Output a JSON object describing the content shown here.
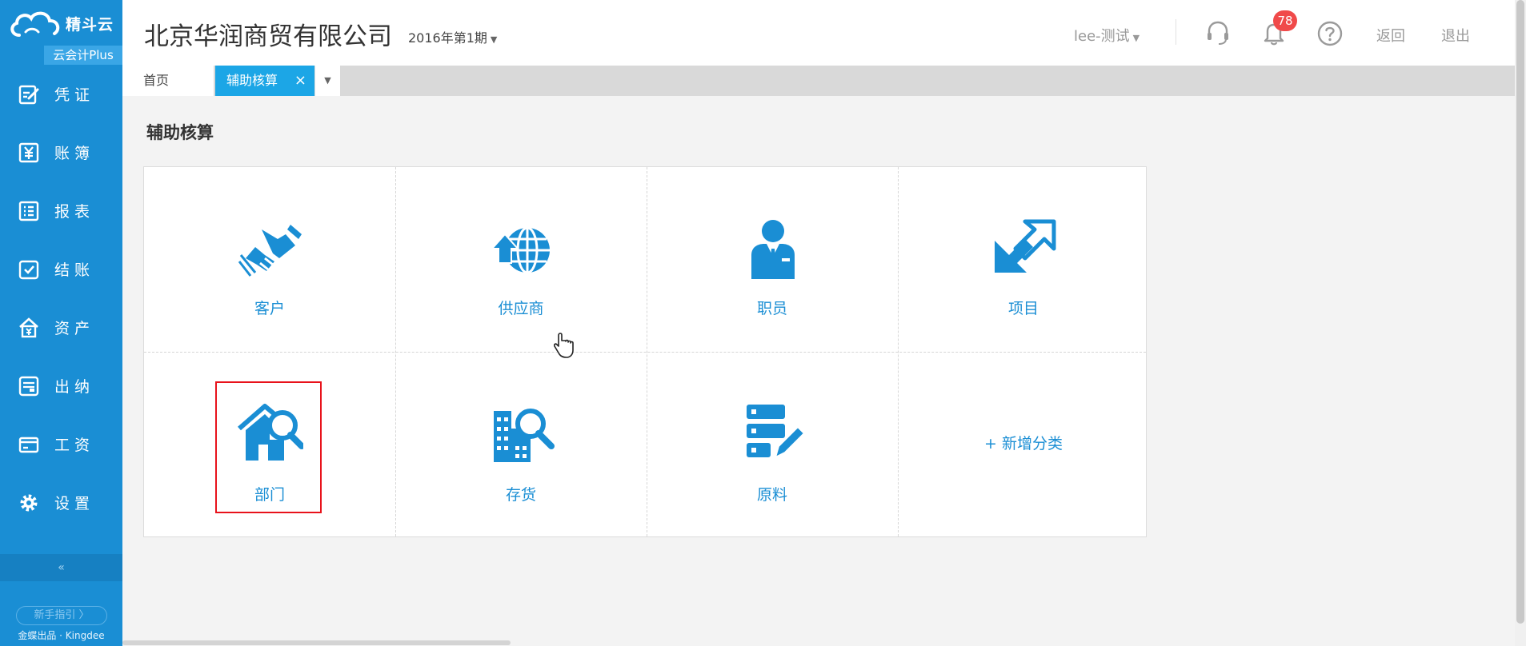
{
  "app": {
    "logo_text": "精斗云",
    "badge": "云会计Plus",
    "guide": "新手指引 〉",
    "footer": "金蝶出品 · Kingdee"
  },
  "sidebar": {
    "items": [
      {
        "label": "凭证",
        "icon": "voucher-icon"
      },
      {
        "label": "账簿",
        "icon": "ledger-icon"
      },
      {
        "label": "报表",
        "icon": "report-icon"
      },
      {
        "label": "结账",
        "icon": "checkout-icon"
      },
      {
        "label": "资产",
        "icon": "asset-icon"
      },
      {
        "label": "出纳",
        "icon": "cashier-icon"
      },
      {
        "label": "工资",
        "icon": "payroll-icon"
      },
      {
        "label": "设置",
        "icon": "gear-icon"
      }
    ],
    "collapse": "«"
  },
  "header": {
    "company": "北京华润商贸有限公司",
    "period": "2016年第1期",
    "user": "lee-测试",
    "notifications": "78",
    "back": "返回",
    "logout": "退出"
  },
  "tabs": {
    "home": "首页",
    "active": "辅助核算",
    "close": "×",
    "more": "▼"
  },
  "main": {
    "title": "辅助核算",
    "categories": [
      {
        "label": "客户",
        "icon": "handshake-icon"
      },
      {
        "label": "供应商",
        "icon": "globe-icon"
      },
      {
        "label": "职员",
        "icon": "staff-icon"
      },
      {
        "label": "项目",
        "icon": "arrows-icon"
      },
      {
        "label": "部门",
        "icon": "house-search-icon"
      },
      {
        "label": "存货",
        "icon": "building-search-icon"
      },
      {
        "label": "原料",
        "icon": "list-edit-icon"
      }
    ],
    "add_category": "+ 新增分类"
  },
  "colors": {
    "sidebar": "#1a8ed4",
    "accent": "#1ca6e6",
    "badge": "#f04a4a",
    "highlight": "#e8121b"
  }
}
